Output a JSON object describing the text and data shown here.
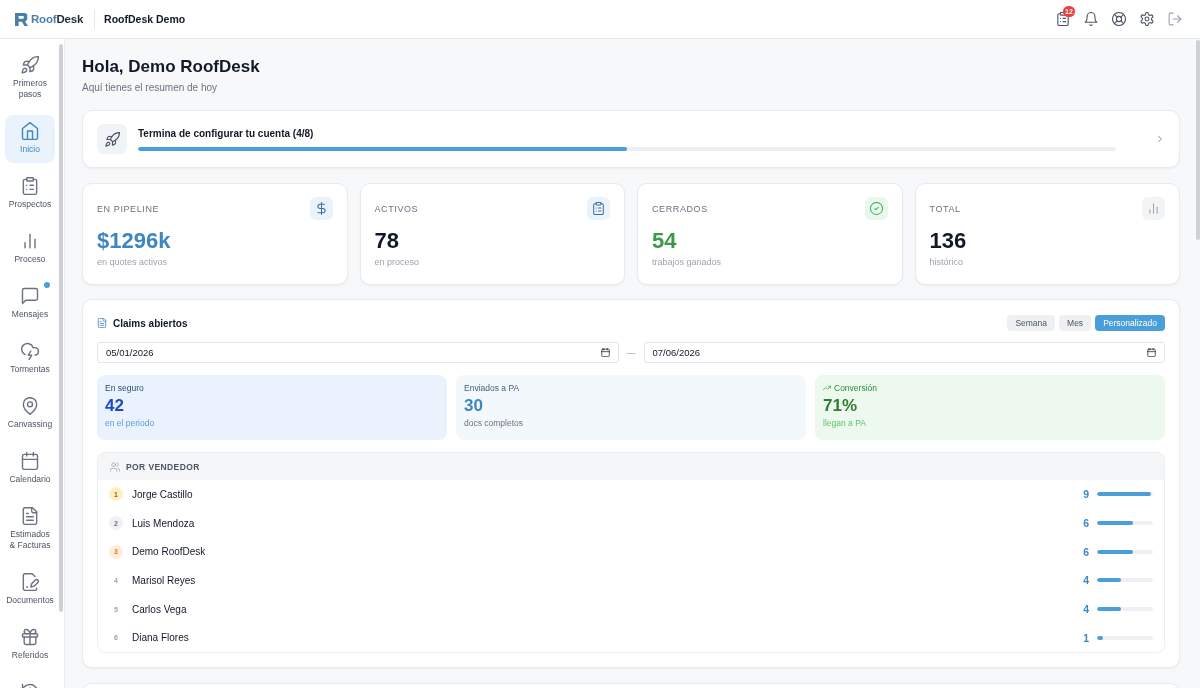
{
  "header": {
    "logo": [
      "Roof",
      "Desk"
    ],
    "workspace": "RoofDesk Demo",
    "notification_badge": "12"
  },
  "sidebar": {
    "items": [
      {
        "label": "Primeros pasos",
        "selected": false,
        "unread": false
      },
      {
        "label": "Inicio",
        "selected": true,
        "unread": false
      },
      {
        "label": "Prospectos",
        "selected": false,
        "unread": false
      },
      {
        "label": "Proceso",
        "selected": false,
        "unread": false
      },
      {
        "label": "Mensajes",
        "selected": false,
        "unread": true
      },
      {
        "label": "Tormentas",
        "selected": false,
        "unread": false
      },
      {
        "label": "Canvassing",
        "selected": false,
        "unread": false
      },
      {
        "label": "Calendario",
        "selected": false,
        "unread": false
      },
      {
        "label": "Estimados & Facturas",
        "selected": false,
        "unread": false
      },
      {
        "label": "Documentos",
        "selected": false,
        "unread": false
      },
      {
        "label": "Referidos",
        "selected": false,
        "unread": false
      },
      {
        "selected": false,
        "unread": false
      }
    ]
  },
  "greeting": {
    "title": "Hola, Demo RoofDesk",
    "subtitle": "Aquí tienes el resumen de hoy"
  },
  "setup": {
    "title": "Termina de configurar tu cuenta (4/8)",
    "level": 0.5
  },
  "stats": [
    {
      "label": "EN PIPELINE",
      "value": "$1296k",
      "caption": "en quotes activos",
      "color": "#3e86c0"
    },
    {
      "label": "ACTIVOS",
      "value": "78",
      "caption": "en proceso",
      "color": "#111827"
    },
    {
      "label": "CERRADOS",
      "value": "54",
      "caption": "trabajos ganados",
      "color": "#3a9a48"
    },
    {
      "label": "TOTAL",
      "value": "136",
      "caption": "histórico",
      "color": "#111827"
    }
  ],
  "claims": {
    "title": "Claims abiertos",
    "periods": [
      {
        "label": "Semana",
        "selected": false
      },
      {
        "label": "Mes",
        "selected": false
      },
      {
        "label": "Personalizado",
        "selected": true
      }
    ],
    "date_from": "05/01/2026",
    "date_separator": "—",
    "date_to": "07/06/2026",
    "metrics": [
      {
        "label": "En seguro",
        "value": "42",
        "caption": "en el periodo",
        "kind": "primary"
      },
      {
        "label": "Enviados a PA",
        "value": "30",
        "caption": "docs completos",
        "kind": "secondary"
      },
      {
        "label": "Conversión",
        "value": "71%",
        "caption": "llegan a PA",
        "kind": "success"
      }
    ],
    "vendors": {
      "title": "POR VENDEDOR",
      "rows": [
        {
          "rank": "1",
          "kind": "gold",
          "name": "Jorge Castillo",
          "count": "9",
          "level": 1
        },
        {
          "rank": "2",
          "kind": "silver",
          "name": "Luis Mendoza",
          "count": "6",
          "level": 0.67
        },
        {
          "rank": "3",
          "kind": "bronze",
          "name": "Demo RoofDesk",
          "count": "6",
          "level": 0.67
        },
        {
          "rank": "4",
          "kind": "plain",
          "name": "Marisol Reyes",
          "count": "4",
          "level": 0.44
        },
        {
          "rank": "5",
          "kind": "plain",
          "name": "Carlos Vega",
          "count": "4",
          "level": 0.44
        },
        {
          "rank": "6",
          "kind": "plain",
          "name": "Diana Flores",
          "count": "1",
          "level": 0.11
        }
      ]
    }
  }
}
